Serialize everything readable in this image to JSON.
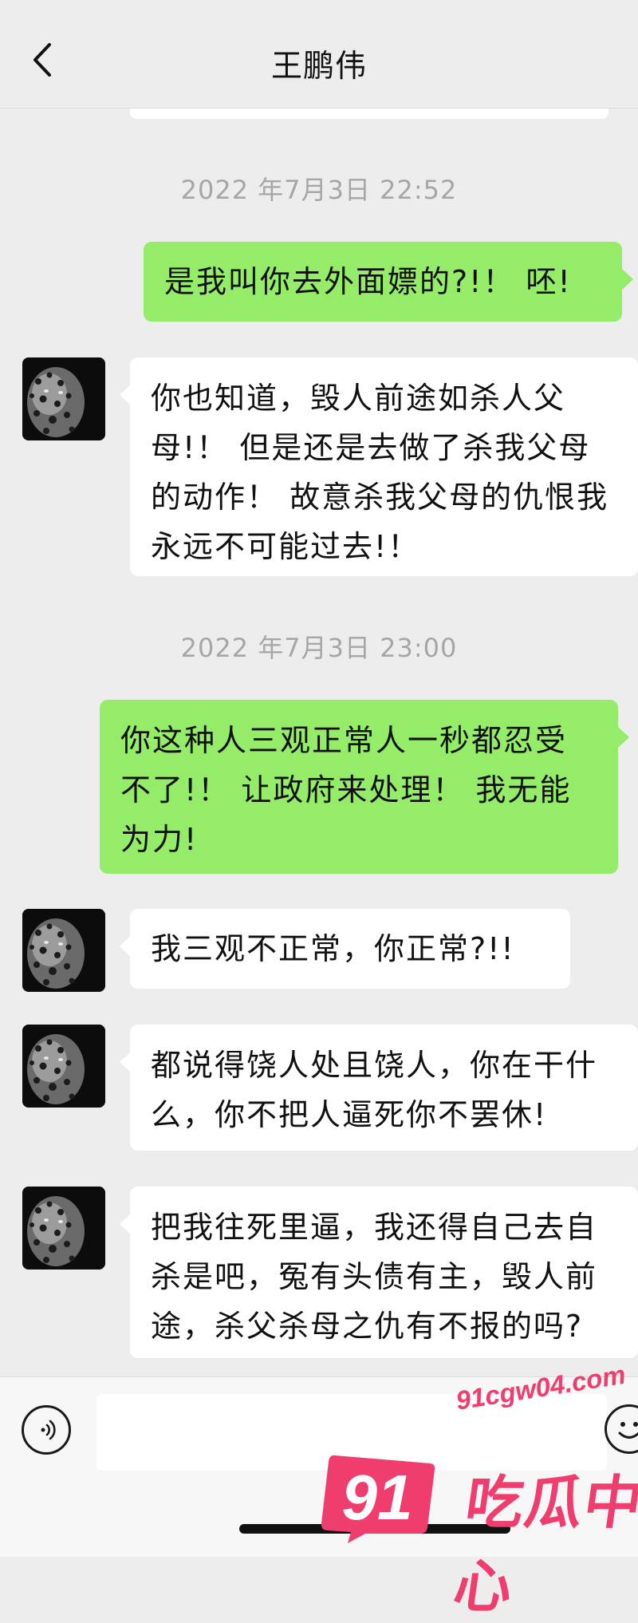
{
  "header": {
    "title": "王鹏伟",
    "back_icon": "chevron-left-icon"
  },
  "messages": [
    {
      "type": "timestamp",
      "text": "2022 年7月3日 22:52"
    },
    {
      "type": "outgoing",
      "text": "是我叫你去外面嫖的?!！ 呸!"
    },
    {
      "type": "incoming",
      "text": "你也知道，毁人前途如杀人父母!！ 但是还是去做了杀我父母的动作！ 故意杀我父母的仇恨我永远不可能过去!！"
    },
    {
      "type": "timestamp",
      "text": "2022 年7月3日 23:00"
    },
    {
      "type": "outgoing",
      "text": "你这种人三观正常人一秒都忍受不了!！ 让政府来处理！ 我无能为力!"
    },
    {
      "type": "incoming",
      "text": "我三观不正常，你正常?!!"
    },
    {
      "type": "incoming",
      "text": "都说得饶人处且饶人，你在干什么，你不把人逼死你不罢休!"
    },
    {
      "type": "incoming",
      "text": "把我往死里逼，我还得自己去自杀是吧，冤有头债有主，毁人前途，杀父杀母之仇有不报的吗?"
    }
  ],
  "input_bar": {
    "voice_icon": "voice-icon",
    "emoji_icon": "emoji-icon",
    "input_value": ""
  },
  "watermark": {
    "url": "91cgw04.com",
    "number": "91",
    "text": "吃瓜中心"
  },
  "colors": {
    "background": "#ededed",
    "outgoing_bubble": "#95ec69",
    "incoming_bubble": "#ffffff",
    "timestamp_text": "#a6a6a6",
    "watermark": "#ef3d6e"
  }
}
